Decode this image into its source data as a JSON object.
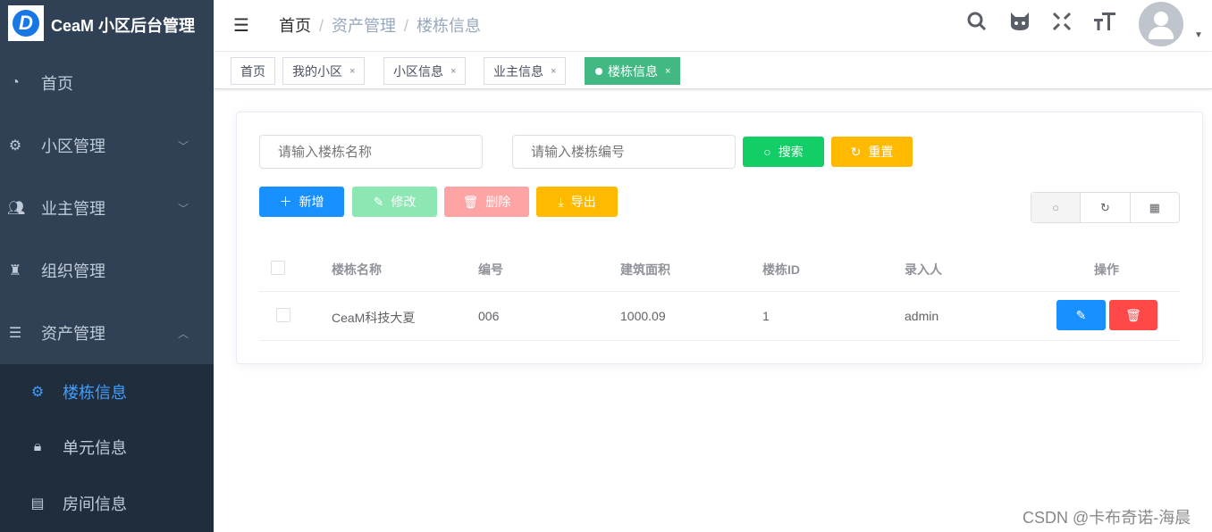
{
  "app": {
    "title": "CeaM 小区后台管理",
    "logo_letter": "D"
  },
  "sidebar": {
    "items": [
      {
        "label": "首页",
        "icon": "dashboard-icon"
      },
      {
        "label": "小区管理",
        "icon": "gear-icon"
      },
      {
        "label": "业主管理",
        "icon": "users-icon"
      },
      {
        "label": "组织管理",
        "icon": "org-icon"
      },
      {
        "label": "资产管理",
        "icon": "list-icon"
      }
    ],
    "sub_items": [
      {
        "label": "楼栋信息",
        "icon": "gear-icon"
      },
      {
        "label": "单元信息",
        "icon": "lock-icon"
      },
      {
        "label": "房间信息",
        "icon": "document-icon"
      }
    ]
  },
  "breadcrumb": [
    "首页",
    "资产管理",
    "楼栋信息"
  ],
  "tabs": [
    "首页",
    "我的小区",
    "小区信息",
    "业主信息",
    "楼栋信息"
  ],
  "search": {
    "name_placeholder": "请输入楼栋名称",
    "code_placeholder": "请输入楼栋编号",
    "search_label": "搜索",
    "reset_label": "重置"
  },
  "actions": {
    "add": "新增",
    "edit": "修改",
    "delete": "删除",
    "export": "导出"
  },
  "table": {
    "headers": [
      "楼栋名称",
      "编号",
      "建筑面积",
      "楼栋ID",
      "录入人",
      "操作"
    ],
    "rows": [
      [
        "CeaM科技大夏",
        "006",
        "1000.09",
        "1",
        "admin"
      ]
    ]
  },
  "watermark": "CSDN @卡布奇诺-海晨",
  "colors": {
    "sidebar": "#304156",
    "primary": "#1890ff",
    "success": "#13ce66",
    "warning": "#ffba00",
    "danger": "#ff4949",
    "tag_active": "#42b983"
  }
}
